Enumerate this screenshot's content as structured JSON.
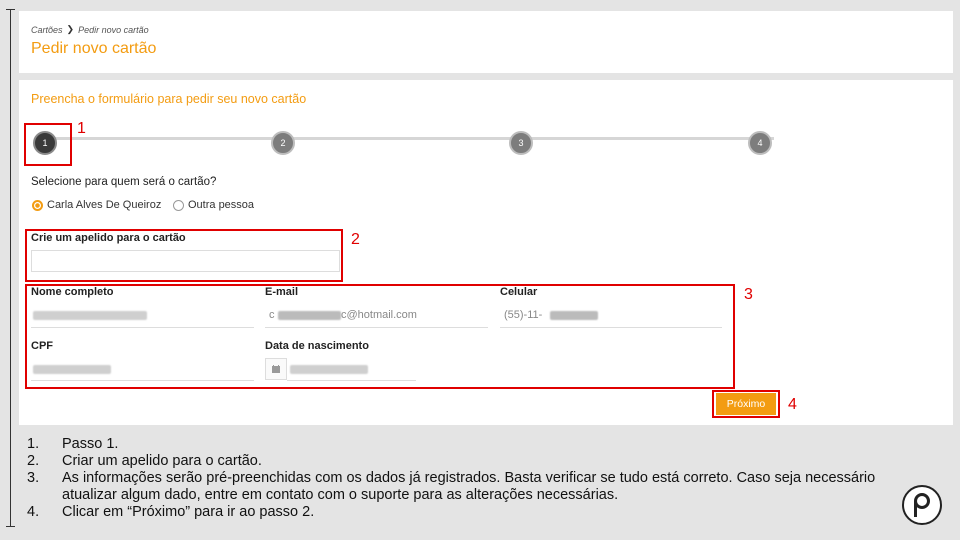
{
  "breadcrumb": {
    "items": [
      "Cartões",
      "Pedir novo cartão"
    ]
  },
  "page_title": "Pedir novo cartão",
  "form": {
    "subtitle": "Preencha o formulário para pedir seu novo cartão",
    "steps": [
      {
        "label": "1",
        "active": true
      },
      {
        "label": "2",
        "active": false
      },
      {
        "label": "3",
        "active": false
      },
      {
        "label": "4",
        "active": false
      }
    ],
    "question": "Selecione para quem será o cartão?",
    "options": [
      {
        "label": "Carla Alves De Queiroz",
        "selected": true
      },
      {
        "label": "Outra pessoa",
        "selected": false
      }
    ],
    "nickname": {
      "label": "Crie um apelido para o cartão",
      "value": ""
    },
    "fields": {
      "nome": {
        "label": "Nome completo",
        "value": ""
      },
      "email": {
        "label": "E-mail",
        "value_prefix": "c",
        "value_suffix": "c@hotmail.com"
      },
      "celular": {
        "label": "Celular",
        "value_prefix": "(55)-11-"
      },
      "cpf": {
        "label": "CPF",
        "value": ""
      },
      "nascimento": {
        "label": "Data de nascimento",
        "value": ""
      }
    },
    "next_button": "Próximo"
  },
  "annotations": [
    "1",
    "2",
    "3",
    "4"
  ],
  "notes": [
    {
      "num": "1.",
      "text": "Passo 1."
    },
    {
      "num": "2.",
      "text": "Criar um apelido para o cartão."
    },
    {
      "num": "3.",
      "text": "As informações serão pré-preenchidas com os dados já registrados. Basta verificar se tudo está correto. Caso seja necessário atualizar algum dado, entre em contato com o suporte para as alterações necessárias."
    },
    {
      "num": "4.",
      "text": "Clicar em “Próximo” para ir ao passo 2."
    }
  ],
  "colors": {
    "accent": "#f39c12",
    "annotation": "#e00000"
  }
}
